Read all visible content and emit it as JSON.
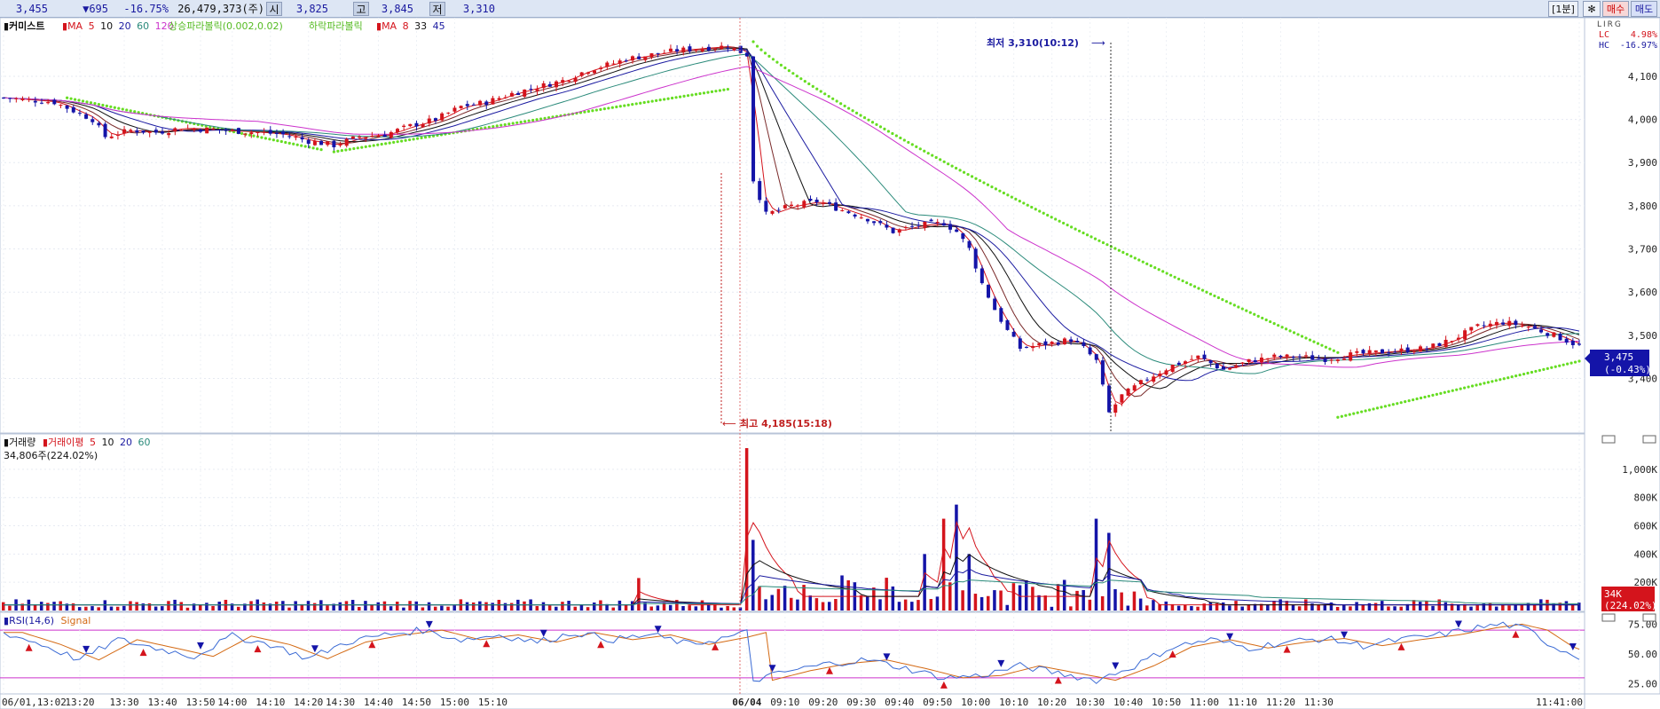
{
  "header": {
    "price": "3,455",
    "change": "▼695",
    "change_pct": "-16.75%",
    "volume": "26,479,373(주)",
    "open_label": "시",
    "open": "3,825",
    "high_label": "고",
    "high": "3,845",
    "low_label": "저",
    "low": "3,310",
    "interval": "[1분]",
    "settings_icon": "gear-icon",
    "buy_label": "매수",
    "sell_label": "매도"
  },
  "price_panel": {
    "title": "커미스트",
    "ma_label": "MA",
    "ma_periods": [
      "5",
      "10",
      "20",
      "60",
      "120"
    ],
    "sar_up_label": "상승파라볼릭(0.002,0.02)",
    "sar_down_label": "하락파라볼릭",
    "ma2_label": "MA",
    "ma2_periods": [
      "8",
      "33",
      "45"
    ],
    "logo_text": "LIRG",
    "lc_label": "LC",
    "lc_value": "4.98%",
    "hc_label": "HC",
    "hc_value": "-16.97%",
    "current_price": "3,475",
    "current_pct": "(-0.43%)",
    "low_annotation": "최저 3,310(10:12)",
    "high_annotation": "최고 4,185(15:18)"
  },
  "volume_panel": {
    "title": "거래량",
    "ma_label": "거래이평",
    "ma_periods": [
      "5",
      "10",
      "20",
      "60"
    ],
    "last_value": "34,806주(224.02%)",
    "current_badge": "34K",
    "current_pct": "(224.02%)"
  },
  "rsi_panel": {
    "title": "RSI(14,6)",
    "signal_label": "Signal"
  },
  "colors": {
    "up": "#d4141c",
    "down": "#1414a8",
    "sar": "#66dd22",
    "ma_long": "#cc33cc"
  },
  "chart_data": {
    "type": "candlestick",
    "price_axis": {
      "ticks": [
        4100,
        4000,
        3900,
        3800,
        3700,
        3600,
        3500,
        3400
      ],
      "tick_labels": [
        "4,100",
        "4,000",
        "3,900",
        "3,800",
        "3,700",
        "3,600",
        "3,500",
        "3,400"
      ],
      "range": [
        3290,
        4215
      ]
    },
    "volume_axis": {
      "ticks": [
        1000000,
        800000,
        600000,
        400000,
        200000
      ],
      "tick_labels": [
        "1,000K",
        "800K",
        "600K",
        "400K",
        "200K"
      ],
      "range": [
        0,
        1150000
      ]
    },
    "rsi_axis": {
      "ticks": [
        75,
        50,
        25
      ],
      "tick_labels": [
        "75.00",
        "50.00",
        "25.00"
      ],
      "range": [
        18,
        82
      ],
      "bands": [
        70,
        30
      ]
    },
    "time_labels": [
      "06/01,13:02",
      "13:20",
      "13:30",
      "13:40",
      "13:50",
      "14:00",
      "14:10",
      "14:20",
      "14:30",
      "14:40",
      "14:50",
      "15:00",
      "15:10",
      "06/04",
      "09:10",
      "09:20",
      "09:30",
      "09:40",
      "09:50",
      "10:00",
      "10:10",
      "10:20",
      "10:30",
      "10:40",
      "10:50",
      "11:00",
      "11:10",
      "11:20",
      "11:30",
      "11:41:00"
    ],
    "price_path": [
      [
        0,
        4050
      ],
      [
        8,
        4040
      ],
      [
        14,
        4000
      ],
      [
        16,
        3960
      ],
      [
        20,
        3975
      ],
      [
        24,
        3970
      ],
      [
        28,
        3980
      ],
      [
        34,
        3975
      ],
      [
        40,
        3970
      ],
      [
        44,
        3965
      ],
      [
        48,
        3950
      ],
      [
        52,
        3940
      ],
      [
        56,
        3960
      ],
      [
        60,
        3965
      ],
      [
        64,
        3985
      ],
      [
        68,
        4000
      ],
      [
        72,
        4030
      ],
      [
        76,
        4040
      ],
      [
        80,
        4060
      ],
      [
        84,
        4075
      ],
      [
        88,
        4090
      ],
      [
        92,
        4115
      ],
      [
        96,
        4130
      ],
      [
        98,
        4140
      ],
      [
        102,
        4150
      ],
      [
        106,
        4160
      ],
      [
        110,
        4165
      ],
      [
        114,
        4170
      ],
      [
        117,
        4150
      ],
      [
        118,
        3860
      ],
      [
        120,
        3780
      ],
      [
        124,
        3800
      ],
      [
        128,
        3810
      ],
      [
        132,
        3790
      ],
      [
        136,
        3770
      ],
      [
        140,
        3740
      ],
      [
        144,
        3755
      ],
      [
        148,
        3760
      ],
      [
        150,
        3740
      ],
      [
        152,
        3700
      ],
      [
        154,
        3620
      ],
      [
        156,
        3560
      ],
      [
        158,
        3510
      ],
      [
        160,
        3470
      ],
      [
        164,
        3480
      ],
      [
        168,
        3490
      ],
      [
        170,
        3470
      ],
      [
        172,
        3440
      ],
      [
        174,
        3320
      ],
      [
        176,
        3360
      ],
      [
        180,
        3400
      ],
      [
        184,
        3430
      ],
      [
        188,
        3450
      ],
      [
        192,
        3420
      ],
      [
        196,
        3440
      ],
      [
        200,
        3450
      ],
      [
        204,
        3450
      ],
      [
        208,
        3445
      ],
      [
        212,
        3455
      ],
      [
        216,
        3460
      ],
      [
        220,
        3465
      ],
      [
        224,
        3470
      ],
      [
        228,
        3490
      ],
      [
        232,
        3520
      ],
      [
        236,
        3530
      ],
      [
        240,
        3520
      ],
      [
        244,
        3500
      ],
      [
        248,
        3475
      ]
    ],
    "volume_spikes": [
      [
        117,
        1150000
      ],
      [
        118,
        500000
      ],
      [
        145,
        400000
      ],
      [
        148,
        650000
      ],
      [
        150,
        750000
      ],
      [
        152,
        400000
      ],
      [
        172,
        650000
      ],
      [
        174,
        550000
      ],
      [
        100,
        230000
      ]
    ],
    "rsi_path": [
      [
        0,
        68
      ],
      [
        6,
        58
      ],
      [
        12,
        45
      ],
      [
        18,
        62
      ],
      [
        24,
        55
      ],
      [
        30,
        48
      ],
      [
        36,
        65
      ],
      [
        42,
        58
      ],
      [
        48,
        46
      ],
      [
        54,
        60
      ],
      [
        60,
        66
      ],
      [
        66,
        70
      ],
      [
        72,
        62
      ],
      [
        78,
        66
      ],
      [
        84,
        60
      ],
      [
        90,
        68
      ],
      [
        96,
        62
      ],
      [
        102,
        66
      ],
      [
        108,
        58
      ],
      [
        114,
        64
      ],
      [
        117,
        68
      ],
      [
        118,
        28
      ],
      [
        124,
        36
      ],
      [
        130,
        42
      ],
      [
        136,
        45
      ],
      [
        142,
        38
      ],
      [
        148,
        30
      ],
      [
        154,
        32
      ],
      [
        160,
        40
      ],
      [
        166,
        34
      ],
      [
        172,
        28
      ],
      [
        178,
        40
      ],
      [
        184,
        56
      ],
      [
        190,
        62
      ],
      [
        196,
        55
      ],
      [
        202,
        60
      ],
      [
        208,
        63
      ],
      [
        214,
        57
      ],
      [
        220,
        62
      ],
      [
        226,
        66
      ],
      [
        232,
        72
      ],
      [
        236,
        75
      ],
      [
        240,
        70
      ],
      [
        244,
        56
      ],
      [
        248,
        48
      ]
    ],
    "sar_up_1": [
      [
        10,
        4050
      ],
      [
        50,
        3930
      ]
    ],
    "sar_up_2": [
      [
        52,
        3925
      ],
      [
        114,
        4070
      ]
    ],
    "sar_down": [
      [
        118,
        4180
      ],
      [
        210,
        3460
      ]
    ],
    "sar_up_3": [
      [
        210,
        3310
      ],
      [
        248,
        3440
      ]
    ]
  }
}
